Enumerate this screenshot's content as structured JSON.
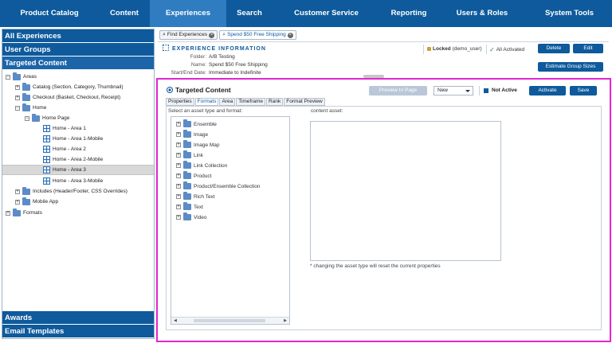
{
  "nav": {
    "items": [
      {
        "label": "Product Catalog"
      },
      {
        "label": "Content"
      },
      {
        "label": "Experiences"
      },
      {
        "label": "Search"
      },
      {
        "label": "Customer Service"
      },
      {
        "label": "Reporting"
      },
      {
        "label": "Users & Roles"
      },
      {
        "label": "System Tools"
      }
    ],
    "active": "Experiences"
  },
  "left_panel": {
    "headers": {
      "all_experiences": "All Experiences",
      "user_groups": "User Groups",
      "targeted_content": "Targeted Content",
      "awards": "Awards",
      "email_templates": "Email Templates"
    },
    "tree": {
      "areas": "Areas",
      "catalog": "Catalog (Section, Category, Thumbnail)",
      "checkout": "Checkout (Basket, Checkout, Receipt)",
      "home": "Home",
      "home_page": "Home Page",
      "area1": "Home - Area 1",
      "area1_mobile": "Home - Area 1-Mobile",
      "area2": "Home - Area 2",
      "area2_mobile": "Home - Area 2-Mobile",
      "area3": "Home - Area 3",
      "area3_mobile": "Home - Area 3-Mobile",
      "includes": "Includes (Header/Footer, CSS Overrides)",
      "mobile_app": "Mobile App",
      "formats": "Formats"
    },
    "selected": "Home - Area 3"
  },
  "breadcrumbs": {
    "find": "Find Experiences",
    "current": "Spend $50 Free Shipping"
  },
  "experience": {
    "title": "EXPERIENCE INFORMATION",
    "folder_label": "Folder:",
    "folder_value": "A/B Testing",
    "name_label": "Name:",
    "name_value": "Spend $50 Free Shipping",
    "dates_label": "Start/End Date:",
    "dates_value": "Immediate to Indefinite",
    "locked_text": "Locked",
    "locked_user": "(demo_user)",
    "activated_text": "All Activated",
    "delete_label": "Delete",
    "edit_label": "Edit",
    "estimate_label": "Estimate Group Sizes"
  },
  "targeted_content": {
    "title": "Targeted Content",
    "preview_label": "Preview In Page",
    "state_value": "New",
    "status_label": "Not Active",
    "activate_label": "Activate",
    "save_label": "Save",
    "tabs": [
      "Properties",
      "Formats",
      "Area",
      "Timeframe",
      "Rank",
      "Format Preview"
    ],
    "active_tab": "Formats",
    "select_label": "Select an asset type and format:",
    "content_asset_label": "content asset:",
    "asset_types": [
      "Ensemble",
      "Image",
      "Image Map",
      "Link",
      "Link Collection",
      "Product",
      "Product/Ensemble Collection",
      "Rich Text",
      "Text",
      "Video"
    ],
    "note": "* changing the asset type will reset the current properties"
  },
  "colors": {
    "nav_bg": "#0e5a9c",
    "nav_active": "#2f7cc1",
    "highlight_border": "#e026d0",
    "button_blue": "#0e5a9c"
  }
}
